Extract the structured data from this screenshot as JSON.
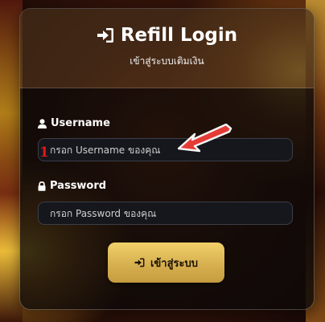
{
  "card": {
    "title": "Refill Login",
    "title_icon": "sign-in-icon",
    "subtitle": "เข้าสู่ระบบเติมเงิน"
  },
  "form": {
    "username": {
      "label": "Username",
      "icon": "user-icon",
      "placeholder": "กรอก Username ของคุณ",
      "value": ""
    },
    "password": {
      "label": "Password",
      "icon": "lock-icon",
      "placeholder": "กรอก Password ของคุณ",
      "value": ""
    },
    "submit": {
      "label": "เข้าสู่ระบบ",
      "icon": "sign-in-icon"
    }
  },
  "annotation": {
    "marker": "1",
    "arrow_color": "#e53b36"
  },
  "colors": {
    "button_gold": "#e2c15d",
    "field_bg": "#16171d"
  }
}
